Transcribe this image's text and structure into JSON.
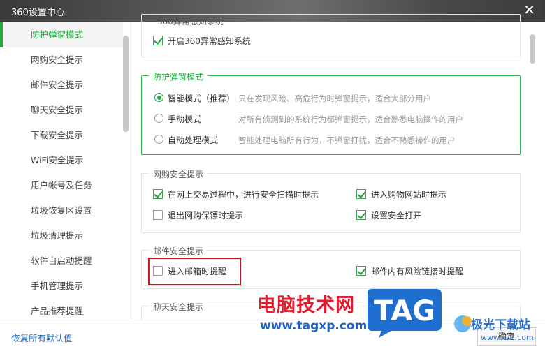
{
  "window": {
    "title": "360设置中心",
    "close_glyph": "✕"
  },
  "sidebar": {
    "items": [
      {
        "label": "防护弹窗模式"
      },
      {
        "label": "网购安全提示"
      },
      {
        "label": "邮件安全提示"
      },
      {
        "label": "聊天安全提示"
      },
      {
        "label": "下载安全提示"
      },
      {
        "label": "WiFi安全提示"
      },
      {
        "label": "用户帐号及任务"
      },
      {
        "label": "垃圾恢复区设置"
      },
      {
        "label": "垃圾清理提示"
      },
      {
        "label": "软件自启动提醒"
      },
      {
        "label": "手机管理提示"
      },
      {
        "label": "产品推荐提醒"
      }
    ],
    "active_index": 0
  },
  "top_section": {
    "partial_title": "360异常感知系统",
    "enable_anomaly": {
      "label": "开启360异常感知系统",
      "checked": true
    }
  },
  "popup_mode": {
    "title": "防护弹窗模式",
    "options": [
      {
        "label": "智能模式（推荐）",
        "desc": "只在发现风险、高危行为时弹窗提示，适合大部分用户",
        "selected": true
      },
      {
        "label": "手动模式",
        "desc": "对所有侦测到的系统行为都弹窗提示，适合熟悉电脑操作的用户",
        "selected": false
      },
      {
        "label": "自动处理模式",
        "desc": "智能处理电脑所有行为，不弹窗打扰，适合不熟悉操作的用户",
        "selected": false
      }
    ]
  },
  "shopping": {
    "title": "网购安全提示",
    "options": [
      {
        "label": "在网上交易过程中，进行安全扫描时提示",
        "checked": true
      },
      {
        "label": "进入购物网站时提示",
        "checked": true
      },
      {
        "label": "退出网购保镖时提示",
        "checked": false
      },
      {
        "label": "设置安全打开",
        "checked": true
      }
    ]
  },
  "mail": {
    "title": "邮件安全提示",
    "options": [
      {
        "label": "进入邮箱时提醒",
        "checked": false
      },
      {
        "label": "邮件内有风险链接时提醒",
        "checked": true
      }
    ]
  },
  "chat": {
    "title": "聊天安全提示"
  },
  "footer": {
    "reset_label": "恢复所有默认值",
    "confirm_label": "确定"
  },
  "watermark": {
    "site_name": "电脑技术网",
    "site_url": "www.tagxp.com",
    "tag_text": "TAG",
    "corner_name": "极光下载站",
    "corner_url": "www.xz7.com"
  },
  "colors": {
    "accent": "#21a93f",
    "highlight": "#d2161e",
    "link": "#2b72c9"
  }
}
